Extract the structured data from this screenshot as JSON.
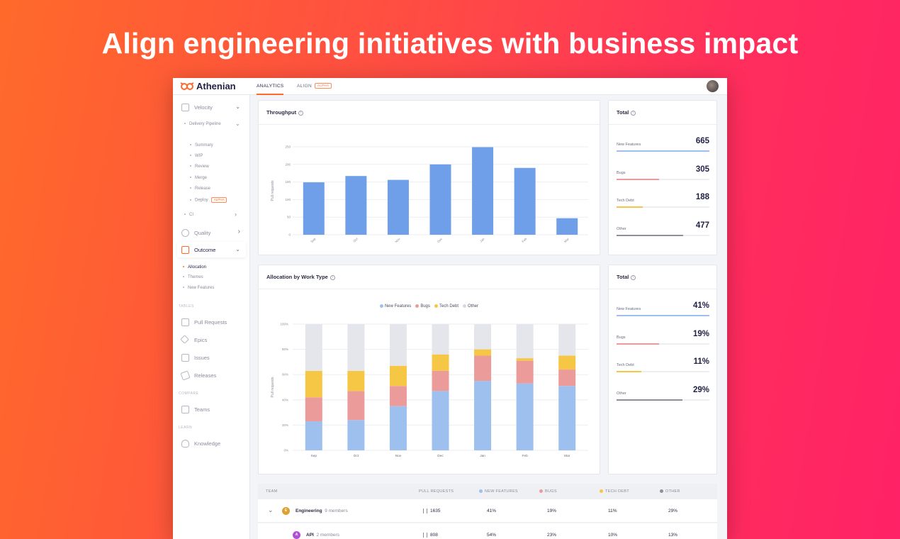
{
  "headline": "Align engineering initiatives with business impact",
  "app": {
    "brand": "Athenian",
    "nav": {
      "analytics": "ANALYTICS",
      "align": "ALIGN",
      "align_badge": "ALPHA"
    }
  },
  "sidebar": {
    "velocity": "Velocity",
    "delivery_pipeline": "Delivery Pipeline",
    "pipeline_items": [
      "Summary",
      "WIP",
      "Review",
      "Merge",
      "Release",
      "Deploy"
    ],
    "deploy_badge": "ALPHA",
    "ci": "CI",
    "quality": "Quality",
    "outcome": "Outcome",
    "outcome_items": [
      "Allocation",
      "Themes",
      "New Features"
    ],
    "section_tables": "TABLES",
    "pull_requests": "Pull Requests",
    "epics": "Epics",
    "issues": "Issues",
    "releases": "Releases",
    "section_compare": "COMPARE",
    "teams": "Teams",
    "section_learn": "LEARN",
    "knowledge": "Knowledge"
  },
  "throughput": {
    "title": "Throughput"
  },
  "allocation": {
    "title": "Allocation by Work Type"
  },
  "totals_top": {
    "title": "Total",
    "rows": [
      {
        "label": "New Features",
        "value": "665",
        "pct": 1.0,
        "color": "#9dc0ef"
      },
      {
        "label": "Bugs",
        "value": "305",
        "pct": 0.46,
        "color": "#ec9b9b"
      },
      {
        "label": "Tech Debt",
        "value": "188",
        "pct": 0.28,
        "color": "#f6c744"
      },
      {
        "label": "Other",
        "value": "477",
        "pct": 0.72,
        "color": "#8d8f9e"
      }
    ]
  },
  "totals_bottom": {
    "title": "Total",
    "rows": [
      {
        "label": "New Features",
        "value": "41%",
        "pct": 1.0,
        "color": "#9dc0ef"
      },
      {
        "label": "Bugs",
        "value": "19%",
        "pct": 0.46,
        "color": "#ec9b9b"
      },
      {
        "label": "Tech Debt",
        "value": "11%",
        "pct": 0.27,
        "color": "#f6c744"
      },
      {
        "label": "Other",
        "value": "29%",
        "pct": 0.71,
        "color": "#8d8f9e"
      }
    ]
  },
  "chart_data": [
    {
      "type": "bar",
      "title": "Throughput",
      "ylabel": "Pull requests",
      "categories": [
        "Sep",
        "Oct",
        "Nov",
        "Dec",
        "Jan",
        "Feb",
        "Mar"
      ],
      "values": [
        149,
        167,
        156,
        200,
        249,
        190,
        47
      ],
      "ylim": [
        0,
        250
      ],
      "yticks": [
        0,
        50,
        100,
        150,
        200,
        250
      ],
      "color": "#6f9fe8",
      "grid": true
    },
    {
      "type": "bar",
      "stacked": true,
      "title": "Allocation by Work Type",
      "ylabel": "Pull requests",
      "categories": [
        "Sep",
        "Oct",
        "Nov",
        "Dec",
        "Jan",
        "Feb",
        "Mar"
      ],
      "yticks": [
        "0%",
        "20%",
        "40%",
        "60%",
        "80%",
        "100%"
      ],
      "ylim": [
        0,
        100
      ],
      "legend_position": "top",
      "series": [
        {
          "name": "New Features",
          "color": "#9dc0ef",
          "values": [
            23,
            24,
            35,
            47,
            55,
            53,
            51
          ]
        },
        {
          "name": "Bugs",
          "color": "#ec9b9b",
          "values": [
            19,
            23,
            16,
            16,
            20,
            18,
            13
          ]
        },
        {
          "name": "Tech Debt",
          "color": "#f6c744",
          "values": [
            21,
            16,
            16,
            13,
            5,
            2,
            11
          ]
        },
        {
          "name": "Other",
          "color": "#e5e6eb",
          "values": [
            37,
            37,
            33,
            24,
            20,
            27,
            25
          ]
        }
      ]
    }
  ],
  "table": {
    "headers": {
      "team": "TEAM",
      "prs": "PULL REQUESTS",
      "nf": "NEW FEATURES",
      "bugs": "BUGS",
      "td": "TECH DEBT",
      "other": "OTHER"
    },
    "rows": [
      {
        "initial": "E",
        "name": "Engineering",
        "members": "9 members",
        "prs": "1635",
        "nf": "41%",
        "bugs": "19%",
        "td": "11%",
        "other": "29%",
        "color": "#e0a030"
      },
      {
        "initial": "A",
        "name": "API",
        "members": "2 members",
        "prs": "808",
        "nf": "54%",
        "bugs": "23%",
        "td": "10%",
        "other": "13%",
        "color": "#b24fd9"
      }
    ]
  }
}
